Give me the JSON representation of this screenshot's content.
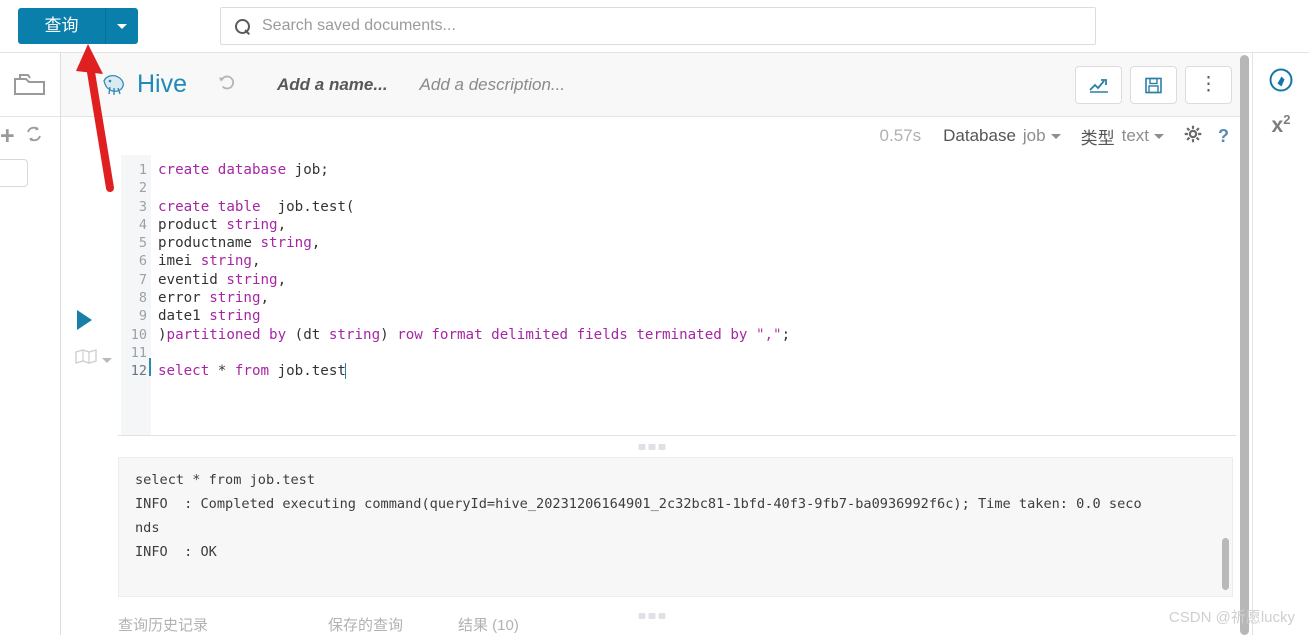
{
  "topbar": {
    "query_button_label": "查询",
    "dropdown_icon": "chevron-down-icon",
    "search_placeholder": "Search saved documents...",
    "search_value": "",
    "search_icon": "search-icon"
  },
  "left_rail": {
    "folder_icon": "folder-icon",
    "add_icon": "plus-icon",
    "refresh_icon": "refresh-icon",
    "filter_value": "",
    "filter_placeholder": ""
  },
  "editor_header": {
    "engine_logo_icon": "hive-elephant-logo-icon",
    "engine_name": "Hive",
    "history_icon": "history-revert-icon",
    "name_placeholder": "Add a name...",
    "description_placeholder": "Add a description...",
    "buttons": [
      {
        "name": "chart-button",
        "icon": "line-chart-icon"
      },
      {
        "name": "save-button",
        "icon": "floppy-save-icon"
      },
      {
        "name": "more-options-button",
        "icon": "kebab-vertical-icon"
      }
    ]
  },
  "meta_strip": {
    "exec_time": "0.57s",
    "database_label": "Database",
    "database_value": "job",
    "type_label": "类型",
    "type_value": "text",
    "settings_icon": "gear-icon",
    "help_icon": "question-mark-icon"
  },
  "editor": {
    "run_icon": "play-triangle-icon",
    "variables_icon": "book-icon",
    "variables_caret_icon": "chevron-down-icon",
    "cursor_line": 12,
    "line_numbers": [
      1,
      2,
      3,
      4,
      5,
      6,
      7,
      8,
      9,
      10,
      11,
      12
    ],
    "lines": [
      "create database job;",
      "",
      "create table  job.test(",
      "product string,",
      "productname string,",
      "imei string,",
      "eventid string,",
      "error string,",
      "date1 string",
      ")partitioned by (dt string) row format delimited fields terminated by \",\";",
      "",
      "select * from job.test"
    ]
  },
  "result_log": {
    "lines": [
      "select * from job.test",
      "INFO  : Completed executing command(queryId=hive_20231206164901_2c32bc81-1bfd-40f3-9fb7-ba0936992f6c); Time taken: 0.0 seco",
      "nds",
      "INFO  : OK"
    ]
  },
  "bottom_tabs": [
    {
      "label": "查询历史记录"
    },
    {
      "label": "保存的查询"
    },
    {
      "label": "结果 (10)"
    }
  ],
  "right_rail": {
    "assist_icon": "compass-assist-icon",
    "functions_icon": "x-squared-icon"
  },
  "watermark": "CSDN @祈愿lucky",
  "colors": {
    "brand_blue": "#0b7fab",
    "link_blue": "#238ab8",
    "keyword_purple": "#a626a4",
    "annotation_red": "#e02020"
  }
}
